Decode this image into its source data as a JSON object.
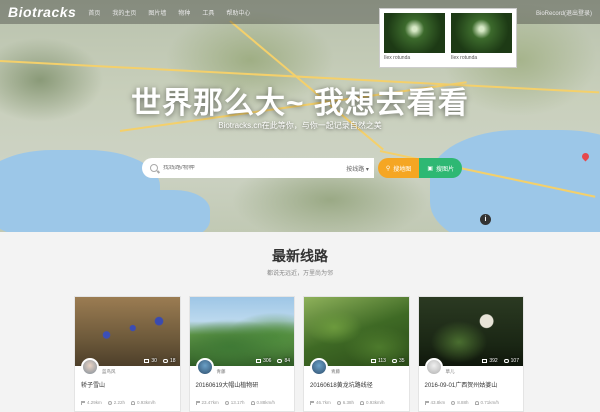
{
  "nav": {
    "logo": "Biotracks",
    "links": [
      "首页",
      "我的主页",
      "图片墙",
      "物种",
      "工具",
      "帮助中心"
    ],
    "user": "BioRecord(退出登录)"
  },
  "thumbs": [
    {
      "caption": "Ilex rotunda"
    },
    {
      "caption": "Ilex rotunda"
    }
  ],
  "hero": {
    "title": "世界那么大~ 我想去看看",
    "subtitle": "Biotracks.cn在此等你，与你一起记录自然之美",
    "search_placeholder": "找线路/物种",
    "search_scope": "按线路 ▾",
    "btn_map": "搜地图",
    "btn_photo": "搜图片"
  },
  "section": {
    "title": "最新线路",
    "subtitle": "都说无远近，万里尚为邻"
  },
  "cards": [
    {
      "author": "蓝鸟风",
      "photos": "30",
      "comments": "18",
      "title": "轿子雪山",
      "distance": "4.29km",
      "duration": "2.22h",
      "speed": "0.93km/h"
    },
    {
      "author": "青藤",
      "photos": "306",
      "comments": "84",
      "title": "20160619大帽山植物研",
      "distance": "23.47km",
      "duration": "13.17h",
      "speed": "0.88km/h"
    },
    {
      "author": "青藤",
      "photos": "113",
      "comments": "35",
      "title": "20160618黄龙坑路线径",
      "distance": "46.7km",
      "duration": "6.38h",
      "speed": "0.93km/h"
    },
    {
      "author": "草儿",
      "photos": "392",
      "comments": "107",
      "title": "2016-09-01广西贺州姑婆山",
      "distance": "43.8km",
      "duration": "8.88h",
      "speed": "0.71km/h"
    }
  ],
  "colors": {
    "map_btn": "#f5a623",
    "photo_btn": "#2eb873",
    "water": "#9cc7e8"
  }
}
